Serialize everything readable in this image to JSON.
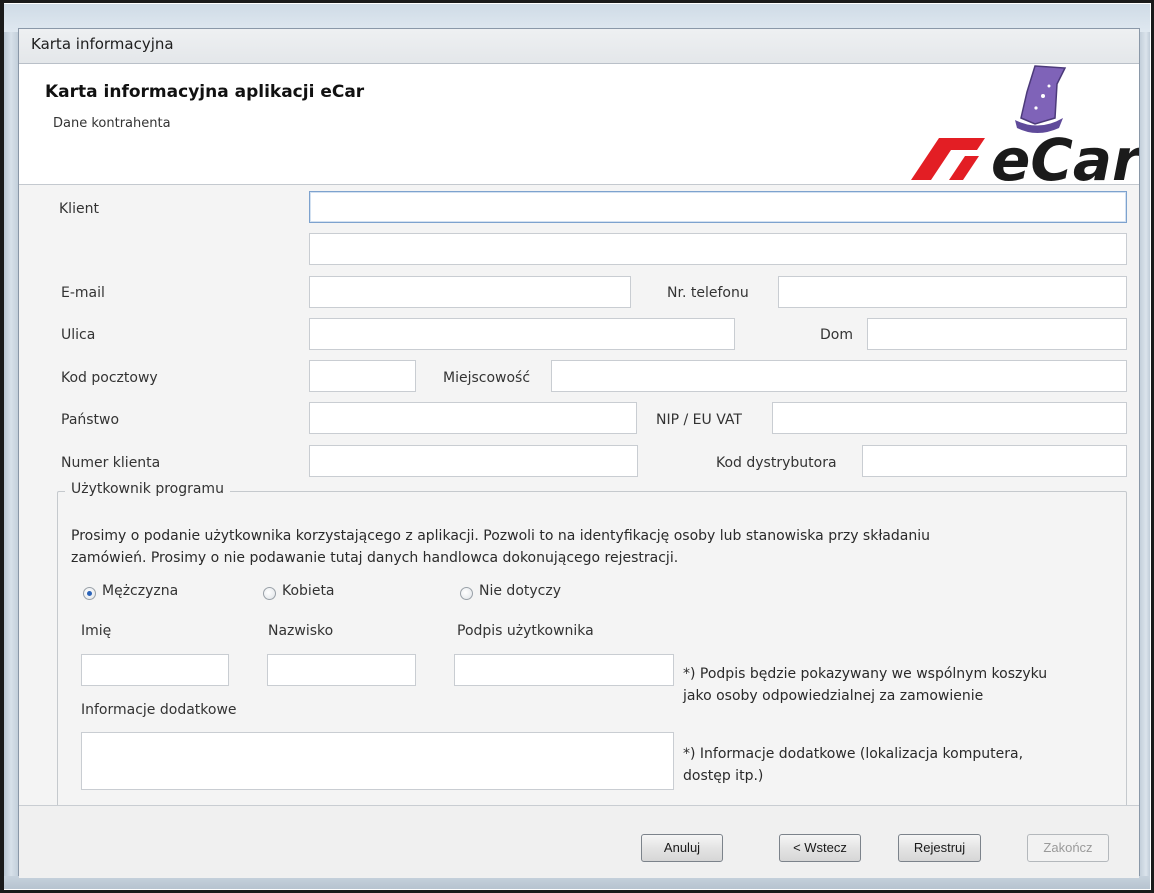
{
  "window": {
    "title": "Karta informacyjna"
  },
  "header": {
    "title": "Karta informacyjna aplikacji eCar",
    "subtitle": "Dane kontrahenta",
    "logo_text": "eCar",
    "logo_color": "#e31e24"
  },
  "form": {
    "klient_label": "Klient",
    "klient_value": "",
    "klient2_value": "",
    "email_label": "E-mail",
    "email_value": "",
    "telefon_label": "Nr. telefonu",
    "telefon_value": "",
    "ulica_label": "Ulica",
    "ulica_value": "",
    "dom_label": "Dom",
    "dom_value": "",
    "kod_label": "Kod pocztowy",
    "kod_value": "",
    "miejscowosc_label": "Miejscowość",
    "miejscowosc_value": "",
    "panstwo_label": "Państwo",
    "panstwo_value": "",
    "nip_label": "NIP / EU VAT",
    "nip_value": "",
    "numer_klienta_label": "Numer klienta",
    "numer_klienta_value": "",
    "kod_dystrybutora_label": "Kod dystrybutora",
    "kod_dystrybutora_value": ""
  },
  "user_group": {
    "legend": "Użytkownik programu",
    "description_line1": "Prosimy o podanie użytkownika korzystającego z aplikacji. Pozwoli to na identyfikację osoby lub stanowiska przy składaniu",
    "description_line2": "zamówień. Prosimy o nie podawanie tutaj danych handlowca dokonującego rejestracji.",
    "gender_options": [
      "Mężczyzna",
      "Kobieta",
      "Nie dotyczy"
    ],
    "gender_selected": "Mężczyzna",
    "imie_label": "Imię",
    "nazwisko_label": "Nazwisko",
    "podpis_label": "Podpis użytkownika",
    "podpis_note_line1": "*) Podpis będzie pokazywany we wspólnym koszyku",
    "podpis_note_line2": "jako osoby odpowiedzialnej za zamowienie",
    "info_label": "Informacje dodatkowe",
    "info_note_line1": "*) Informacje dodatkowe (lokalizacja komputera,",
    "info_note_line2": "dostęp itp.)"
  },
  "footer": {
    "cancel_label": "Anuluj",
    "back_label": "< Wstecz",
    "register_label": "Rejestruj",
    "finish_label": "Zakończ"
  }
}
